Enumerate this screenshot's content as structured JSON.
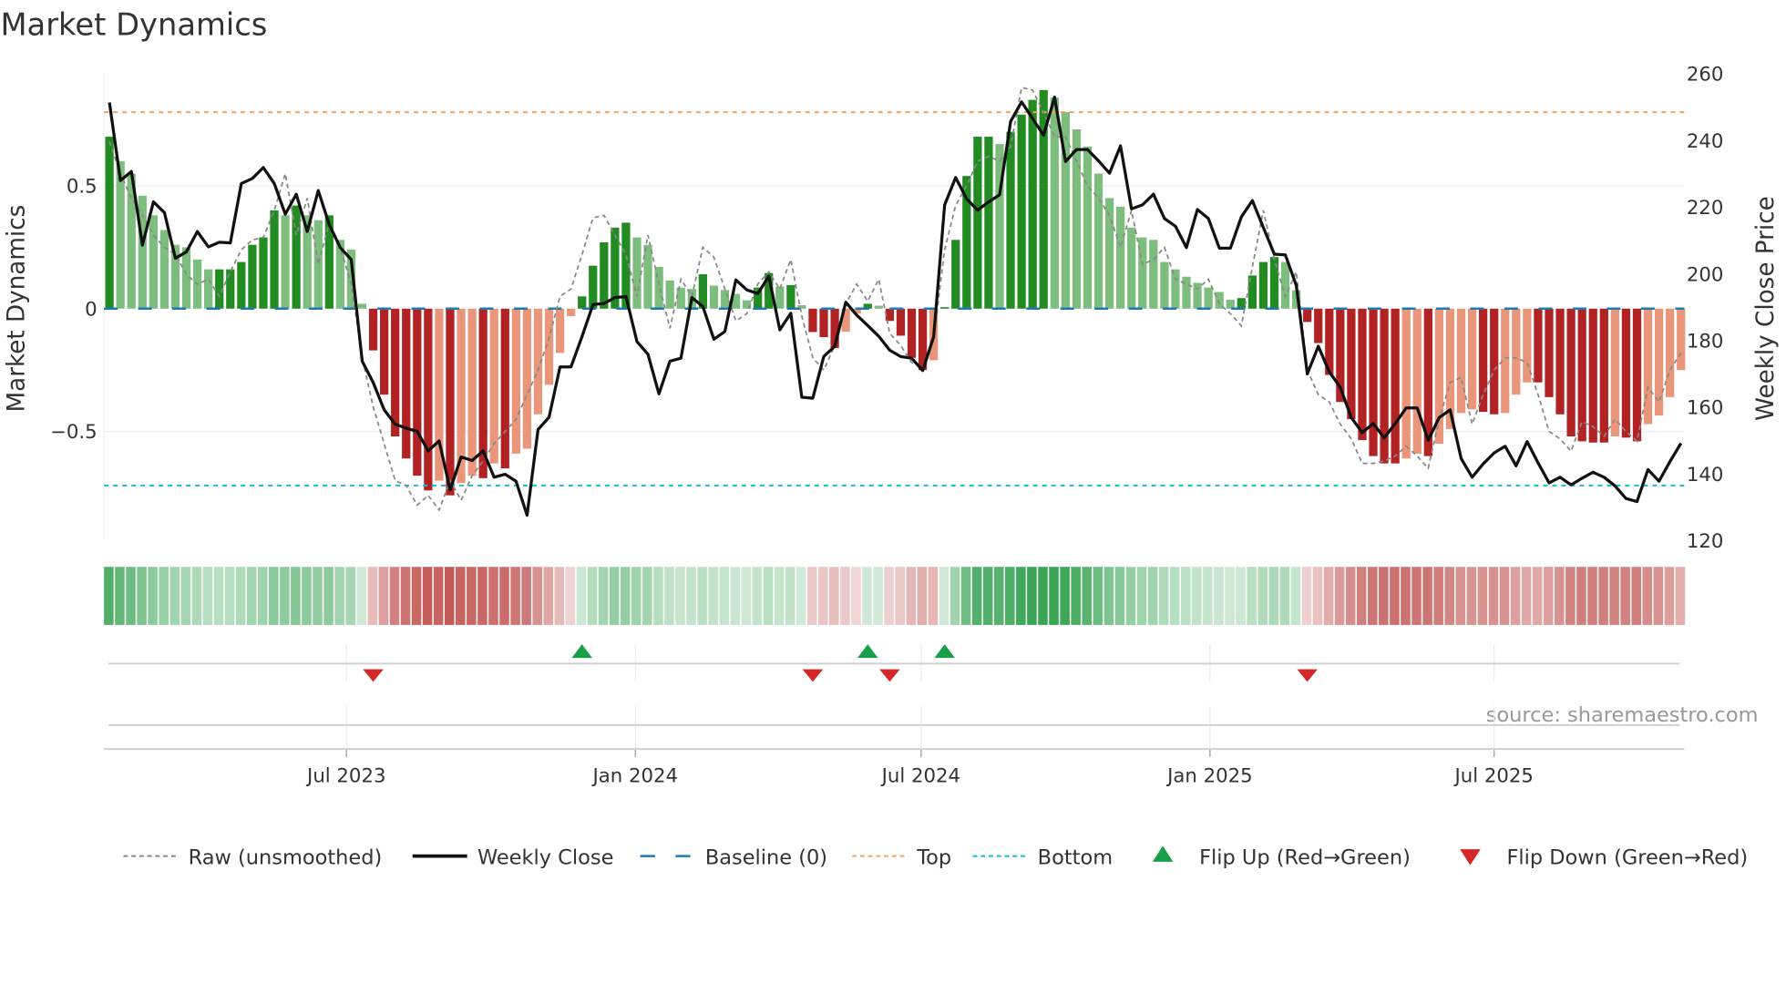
{
  "chart_data": {
    "type": "bar",
    "title": "Market Dynamics",
    "ylabel": "Market Dynamics",
    "y2label": "Weekly Close Price",
    "source": "source: sharemaestro.com",
    "x_start": "2023-01-31",
    "x_step_days": 7,
    "xticks": [
      {
        "date": "2023-07-01",
        "label": "Jul 2023"
      },
      {
        "date": "2024-01-01",
        "label": "Jan 2024"
      },
      {
        "date": "2024-07-01",
        "label": "Jul 2024"
      },
      {
        "date": "2025-01-01",
        "label": "Jan 2025"
      },
      {
        "date": "2025-07-01",
        "label": "Jul 2025"
      }
    ],
    "ylim": [
      -0.94,
      0.96
    ],
    "yticks": [
      {
        "v": 0.5,
        "label": "0.5"
      },
      {
        "v": 0,
        "label": "0"
      },
      {
        "v": -0.5,
        "label": "−0.5"
      }
    ],
    "y2lim": [
      120,
      260
    ],
    "y2ticks": [
      260,
      240,
      220,
      200,
      180,
      160,
      140,
      120
    ],
    "top_level": 0.8,
    "bottom_level": -0.72,
    "baseline": 0,
    "momentum": [
      0.7,
      0.6,
      0.55,
      0.46,
      0.38,
      0.32,
      0.26,
      0.25,
      0.2,
      0.16,
      0.16,
      0.16,
      0.19,
      0.26,
      0.29,
      0.4,
      0.38,
      0.42,
      0.38,
      0.36,
      0.38,
      0.28,
      0.24,
      0.02,
      -0.17,
      -0.35,
      -0.52,
      -0.61,
      -0.68,
      -0.74,
      -0.7,
      -0.76,
      -0.71,
      -0.68,
      -0.69,
      -0.63,
      -0.65,
      -0.59,
      -0.57,
      -0.43,
      -0.31,
      -0.18,
      -0.03,
      0.05,
      0.175,
      0.27,
      0.33,
      0.35,
      0.29,
      0.26,
      0.17,
      0.115,
      0.086,
      0.08,
      0.14,
      0.094,
      0.076,
      0.06,
      0.034,
      0.086,
      0.145,
      0.09,
      0.096,
      0.014,
      -0.095,
      -0.116,
      -0.16,
      -0.094,
      -0.02,
      0.02,
      0.012,
      -0.05,
      -0.11,
      -0.2,
      -0.25,
      -0.21,
      0.006,
      0.28,
      0.54,
      0.7,
      0.7,
      0.67,
      0.72,
      0.79,
      0.85,
      0.89,
      0.86,
      0.8,
      0.73,
      0.66,
      0.55,
      0.45,
      0.415,
      0.33,
      0.29,
      0.28,
      0.19,
      0.16,
      0.13,
      0.105,
      0.086,
      0.068,
      0.036,
      0.043,
      0.135,
      0.19,
      0.21,
      0.19,
      0.075,
      -0.054,
      -0.14,
      -0.27,
      -0.38,
      -0.45,
      -0.535,
      -0.6,
      -0.63,
      -0.63,
      -0.61,
      -0.59,
      -0.6,
      -0.55,
      -0.49,
      -0.425,
      -0.41,
      -0.42,
      -0.43,
      -0.425,
      -0.35,
      -0.3,
      -0.3,
      -0.36,
      -0.43,
      -0.52,
      -0.54,
      -0.545,
      -0.545,
      -0.52,
      -0.525,
      -0.54,
      -0.47,
      -0.435,
      -0.36,
      -0.25
    ],
    "raw": [
      0.68,
      0.55,
      0.45,
      0.38,
      0.3,
      0.25,
      0.22,
      0.14,
      0.1,
      0.12,
      0.05,
      0.15,
      0.24,
      0.28,
      0.29,
      0.4,
      0.55,
      0.3,
      0.45,
      0.18,
      0.35,
      0.25,
      0.1,
      -0.2,
      -0.4,
      -0.55,
      -0.7,
      -0.72,
      -0.8,
      -0.76,
      -0.82,
      -0.7,
      -0.78,
      -0.68,
      -0.62,
      -0.55,
      -0.5,
      -0.45,
      -0.35,
      -0.25,
      -0.12,
      0.05,
      0.08,
      0.22,
      0.37,
      0.38,
      0.3,
      0.22,
      0.05,
      0.3,
      0.1,
      -0.08,
      0.12,
      0.05,
      0.25,
      0.21,
      0.08,
      -0.05,
      -0.02,
      0.1,
      0.15,
      0.08,
      0.2,
      -0.03,
      -0.2,
      -0.25,
      -0.15,
      0.02,
      0.1,
      0.03,
      0.12,
      -0.1,
      -0.15,
      -0.22,
      -0.24,
      -0.12,
      0.24,
      0.42,
      0.5,
      0.6,
      0.62,
      0.6,
      0.66,
      0.9,
      0.89,
      0.8,
      0.7,
      0.7,
      0.6,
      0.5,
      0.45,
      0.38,
      0.25,
      0.4,
      0.18,
      0.2,
      0.25,
      0.12,
      0.1,
      0.08,
      0.12,
      0.02,
      -0.02,
      -0.07,
      0.17,
      0.4,
      0.2,
      0.05,
      0.15,
      -0.25,
      -0.35,
      -0.38,
      -0.47,
      -0.53,
      -0.63,
      -0.63,
      -0.62,
      -0.6,
      -0.56,
      -0.6,
      -0.65,
      -0.45,
      -0.3,
      -0.28,
      -0.47,
      -0.35,
      -0.25,
      -0.2,
      -0.2,
      -0.22,
      -0.35,
      -0.5,
      -0.53,
      -0.58,
      -0.46,
      -0.48,
      -0.52,
      -0.45,
      -0.5,
      -0.54,
      -0.32,
      -0.38,
      -0.25,
      -0.18
    ],
    "weekly_close": [
      251.1,
      227.7,
      230.4,
      208.3,
      221.3,
      218.1,
      204.4,
      206.3,
      212.4,
      207.8,
      209.2,
      209.0,
      226.8,
      228.3,
      231.6,
      226.8,
      217.6,
      223.6,
      212.4,
      224.7,
      214.5,
      207.6,
      204.0,
      173.5,
      167.1,
      158.9,
      154.6,
      153.4,
      152.5,
      146.6,
      149.6,
      134.9,
      144.8,
      143.7,
      146.6,
      138.7,
      139.6,
      137.5,
      127.3,
      153.0,
      156.7,
      171.8,
      171.8,
      180.9,
      190.5,
      190.8,
      192.6,
      192.9,
      179.4,
      175.6,
      163.7,
      173.5,
      174.4,
      192.6,
      189.9,
      180.1,
      182.4,
      197.9,
      194.9,
      193.8,
      199.0,
      182.9,
      187.9,
      162.7,
      162.4,
      174.9,
      178.0,
      191.2,
      187.3,
      184.2,
      181.0,
      176.8,
      174.9,
      174.4,
      170.7,
      180.8,
      220.4,
      228.6,
      222.2,
      218.8,
      221.3,
      223.4,
      245.4,
      251.3,
      246.3,
      241.3,
      252.7,
      233.4,
      237.0,
      237.0,
      233.6,
      229.9,
      238.1,
      219.2,
      220.4,
      223.6,
      216.3,
      214.0,
      207.6,
      219.0,
      216.3,
      207.4,
      207.4,
      216.8,
      221.7,
      213.6,
      205.6,
      205.4,
      196.2,
      169.7,
      178.0,
      170.3,
      165.7,
      156.6,
      152.1,
      154.8,
      150.5,
      154.8,
      159.5,
      159.5,
      149.8,
      156.6,
      158.9,
      144.3,
      138.7,
      142.7,
      146.0,
      148.0,
      142.1,
      149.4,
      143.0,
      137.0,
      138.7,
      136.4,
      138.4,
      140.2,
      138.7,
      136.1,
      132.3,
      131.4,
      141.0,
      137.5,
      143.4,
      148.9
    ],
    "flips": [
      {
        "index": 24,
        "type": "down"
      },
      {
        "index": 43,
        "type": "up"
      },
      {
        "index": 64,
        "type": "down"
      },
      {
        "index": 69,
        "type": "up"
      },
      {
        "index": 71,
        "type": "down"
      },
      {
        "index": 76,
        "type": "up"
      },
      {
        "index": 109,
        "type": "down"
      }
    ],
    "colors": {
      "green_strong": "#228b22",
      "green_weak": "#7dbd7d",
      "red_strong": "#b22222",
      "red_weak": "#e9967a",
      "strip_green": "#3aa555",
      "strip_red": "#c0504d",
      "flip_up": "#1a9e4a",
      "flip_down": "#d62728",
      "top": "#f4a261",
      "bottom": "#17becf",
      "baseline": "#1f77b4",
      "raw": "#888888",
      "close": "#111111"
    },
    "legend": [
      {
        "key": "raw",
        "label": "Raw (unsmoothed)"
      },
      {
        "key": "close",
        "label": "Weekly Close"
      },
      {
        "key": "baseline",
        "label": "Baseline (0)"
      },
      {
        "key": "top",
        "label": "Top"
      },
      {
        "key": "bottom",
        "label": "Bottom"
      },
      {
        "key": "flip_up",
        "label": "Flip Up (Red→Green)"
      },
      {
        "key": "flip_down",
        "label": "Flip Down (Green→Red)"
      }
    ],
    "legend_position": "bottom"
  }
}
